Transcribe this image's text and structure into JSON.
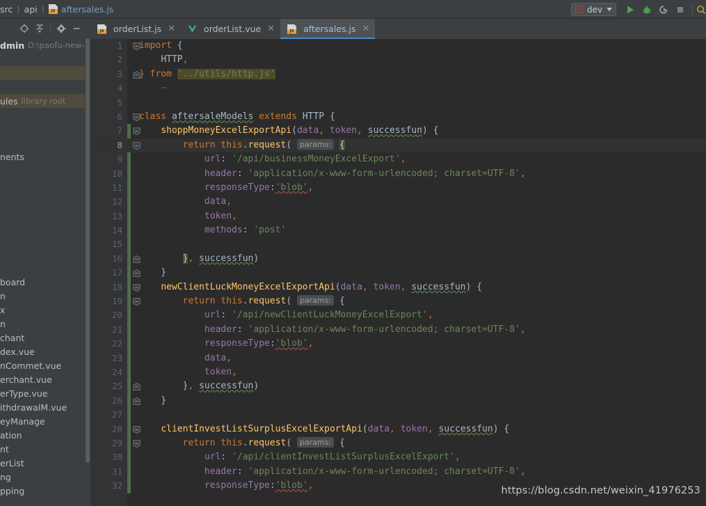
{
  "window": {
    "breadcrumb": [
      {
        "label": "src",
        "type": "folder"
      },
      {
        "label": "api",
        "type": "folder"
      },
      {
        "label": "aftersales.js",
        "type": "js-file"
      }
    ]
  },
  "toolbar": {
    "run_config": {
      "label": "dev",
      "icon": "run-config-icon"
    },
    "buttons": [
      {
        "name": "run-button",
        "glyph": "play",
        "color": "#4ea14e"
      },
      {
        "name": "debug-button",
        "glyph": "bug",
        "color": "#4ea14e"
      },
      {
        "name": "rerun-button",
        "glyph": "rerun",
        "color": "#9aa0a6"
      },
      {
        "name": "stop-button",
        "glyph": "stop",
        "color": "#7d7d7d"
      },
      {
        "name": "search-everywhere-icon",
        "glyph": "magnifier",
        "color": "#c0a050"
      }
    ]
  },
  "sidebar": {
    "toolbar_buttons": [
      {
        "name": "select-opened-file-icon",
        "glyph": "crosshair"
      },
      {
        "name": "collapse-all-icon",
        "glyph": "collapse"
      },
      {
        "name": "settings-gear-icon",
        "glyph": "gear"
      },
      {
        "name": "hide-panel-icon",
        "glyph": "minus"
      }
    ],
    "tree": [
      {
        "label": "dmin",
        "suffix": "D:\\paofu-new-ad",
        "bold": true,
        "kind": "project-root",
        "selected": false
      },
      {
        "label": "",
        "suffix": "",
        "kind": "spacer",
        "selected": false
      },
      {
        "label": "",
        "suffix": "",
        "kind": "row",
        "selected": true
      },
      {
        "label": "",
        "suffix": "",
        "kind": "row",
        "selected": false
      },
      {
        "label": "ules",
        "suffix": "library root",
        "kind": "library-root",
        "selected": true,
        "color": "yellow"
      },
      {
        "label": "",
        "suffix": "",
        "kind": "row",
        "selected": false
      },
      {
        "label": "",
        "suffix": "",
        "kind": "row",
        "selected": false
      },
      {
        "label": "",
        "suffix": "",
        "kind": "row",
        "selected": false
      },
      {
        "label": "nents",
        "suffix": "",
        "kind": "folder",
        "selected": false
      },
      {
        "label": "",
        "suffix": "",
        "kind": "row",
        "selected": false
      },
      {
        "label": "",
        "suffix": "",
        "kind": "row",
        "selected": false
      },
      {
        "label": "",
        "suffix": "",
        "kind": "row",
        "selected": false
      },
      {
        "label": "",
        "suffix": "",
        "kind": "row",
        "selected": false
      },
      {
        "label": "",
        "suffix": "",
        "kind": "row",
        "selected": false
      },
      {
        "label": "",
        "suffix": "",
        "kind": "row",
        "selected": false
      },
      {
        "label": "",
        "suffix": "",
        "kind": "row",
        "selected": false
      },
      {
        "label": "",
        "suffix": "",
        "kind": "row",
        "selected": false
      },
      {
        "label": "board",
        "suffix": "",
        "kind": "folder",
        "selected": false
      },
      {
        "label": "n",
        "suffix": "",
        "kind": "file",
        "selected": false,
        "color": "yellow"
      },
      {
        "label": "x",
        "suffix": "",
        "kind": "file",
        "selected": false,
        "color": "yellow"
      },
      {
        "label": "n",
        "suffix": "",
        "kind": "file",
        "selected": false,
        "color": "yellow"
      },
      {
        "label": "chant",
        "suffix": "",
        "kind": "folder",
        "selected": false
      },
      {
        "label": "dex.vue",
        "suffix": "",
        "kind": "file",
        "selected": false,
        "color": "yellow"
      },
      {
        "label": "nCommet.vue",
        "suffix": "",
        "kind": "file",
        "selected": false,
        "color": "yellow"
      },
      {
        "label": "erchant.vue",
        "suffix": "",
        "kind": "file",
        "selected": false,
        "color": "yellow"
      },
      {
        "label": "erType.vue",
        "suffix": "",
        "kind": "file",
        "selected": false,
        "color": "blue"
      },
      {
        "label": "ithdrawalM.vue",
        "suffix": "",
        "kind": "file",
        "selected": false,
        "color": "blue"
      },
      {
        "label": "eyManage",
        "suffix": "",
        "kind": "folder",
        "selected": false,
        "color": "yellow"
      },
      {
        "label": "ation",
        "suffix": "",
        "kind": "folder",
        "selected": false
      },
      {
        "label": "nt",
        "suffix": "",
        "kind": "folder",
        "selected": false
      },
      {
        "label": "erList",
        "suffix": "",
        "kind": "folder",
        "selected": false
      },
      {
        "label": "ng",
        "suffix": "",
        "kind": "folder",
        "selected": false
      },
      {
        "label": "pping",
        "suffix": "",
        "kind": "folder",
        "selected": false
      }
    ]
  },
  "tabs": [
    {
      "label": "orderList.js",
      "icon": "js-file-icon",
      "active": false
    },
    {
      "label": "orderList.vue",
      "icon": "vue-file-icon",
      "active": false
    },
    {
      "label": "aftersales.js",
      "icon": "js-file-icon",
      "active": true
    }
  ],
  "editor": {
    "current_line": 8,
    "change_marker_start_line": 7,
    "change_marker_end_line": 32,
    "lines": [
      {
        "n": 1,
        "fold": "open",
        "indent": 0,
        "text": "import {"
      },
      {
        "n": 2,
        "fold": "",
        "indent": 1,
        "text": "HTTP,"
      },
      {
        "n": 3,
        "fold": "close",
        "indent": 0,
        "text": "} from '../utils/http.js'"
      },
      {
        "n": 4,
        "fold": "",
        "indent": 1,
        "text": "~"
      },
      {
        "n": 5,
        "fold": "",
        "indent": 0,
        "text": ""
      },
      {
        "n": 6,
        "fold": "open",
        "indent": 0,
        "text": "class aftersaleModels extends HTTP {"
      },
      {
        "n": 7,
        "fold": "open",
        "indent": 1,
        "text": "shoppMoneyExcelExportApi(data, token, successfun) {"
      },
      {
        "n": 8,
        "fold": "open",
        "indent": 2,
        "text": "return this.request( params: {"
      },
      {
        "n": 9,
        "fold": "",
        "indent": 3,
        "text": "url: '/api/businessMoneyExcelExport',"
      },
      {
        "n": 10,
        "fold": "",
        "indent": 3,
        "text": "header: 'application/x-www-form-urlencoded; charset=UTF-8',"
      },
      {
        "n": 11,
        "fold": "",
        "indent": 3,
        "text": "responseType:'blob',"
      },
      {
        "n": 12,
        "fold": "",
        "indent": 3,
        "text": "data,"
      },
      {
        "n": 13,
        "fold": "",
        "indent": 3,
        "text": "token,"
      },
      {
        "n": 14,
        "fold": "",
        "indent": 3,
        "text": "methods: 'post'"
      },
      {
        "n": 15,
        "fold": "",
        "indent": 0,
        "text": ""
      },
      {
        "n": 16,
        "fold": "close",
        "indent": 2,
        "text": "}, successfun)"
      },
      {
        "n": 17,
        "fold": "close",
        "indent": 1,
        "text": "}"
      },
      {
        "n": 18,
        "fold": "open",
        "indent": 1,
        "text": "newClientLuckMoneyExcelExportApi(data, token, successfun) {"
      },
      {
        "n": 19,
        "fold": "open",
        "indent": 2,
        "text": "return this.request( params: {"
      },
      {
        "n": 20,
        "fold": "",
        "indent": 3,
        "text": "url: '/api/newClientLuckMoneyExcelExport',"
      },
      {
        "n": 21,
        "fold": "",
        "indent": 3,
        "text": "header: 'application/x-www-form-urlencoded; charset=UTF-8',"
      },
      {
        "n": 22,
        "fold": "",
        "indent": 3,
        "text": "responseType:'blob',"
      },
      {
        "n": 23,
        "fold": "",
        "indent": 3,
        "text": "data,"
      },
      {
        "n": 24,
        "fold": "",
        "indent": 3,
        "text": "token,"
      },
      {
        "n": 25,
        "fold": "close",
        "indent": 2,
        "text": "}, successfun)"
      },
      {
        "n": 26,
        "fold": "close",
        "indent": 1,
        "text": "}"
      },
      {
        "n": 27,
        "fold": "",
        "indent": 0,
        "text": ""
      },
      {
        "n": 28,
        "fold": "open",
        "indent": 1,
        "text": "clientInvestListSurplusExcelExportApi(data, token, successfun) {"
      },
      {
        "n": 29,
        "fold": "open",
        "indent": 2,
        "text": "return this.request( params: {"
      },
      {
        "n": 30,
        "fold": "",
        "indent": 3,
        "text": "url: '/api/clientInvestListSurplusExcelExport',"
      },
      {
        "n": 31,
        "fold": "",
        "indent": 3,
        "text": "header: 'application/x-www-form-urlencoded; charset=UTF-8',"
      },
      {
        "n": 32,
        "fold": "",
        "indent": 3,
        "text": "responseType:'blob',"
      }
    ],
    "inlay_hint": "params:"
  },
  "watermark": "https://blog.csdn.net/weixin_41976253"
}
